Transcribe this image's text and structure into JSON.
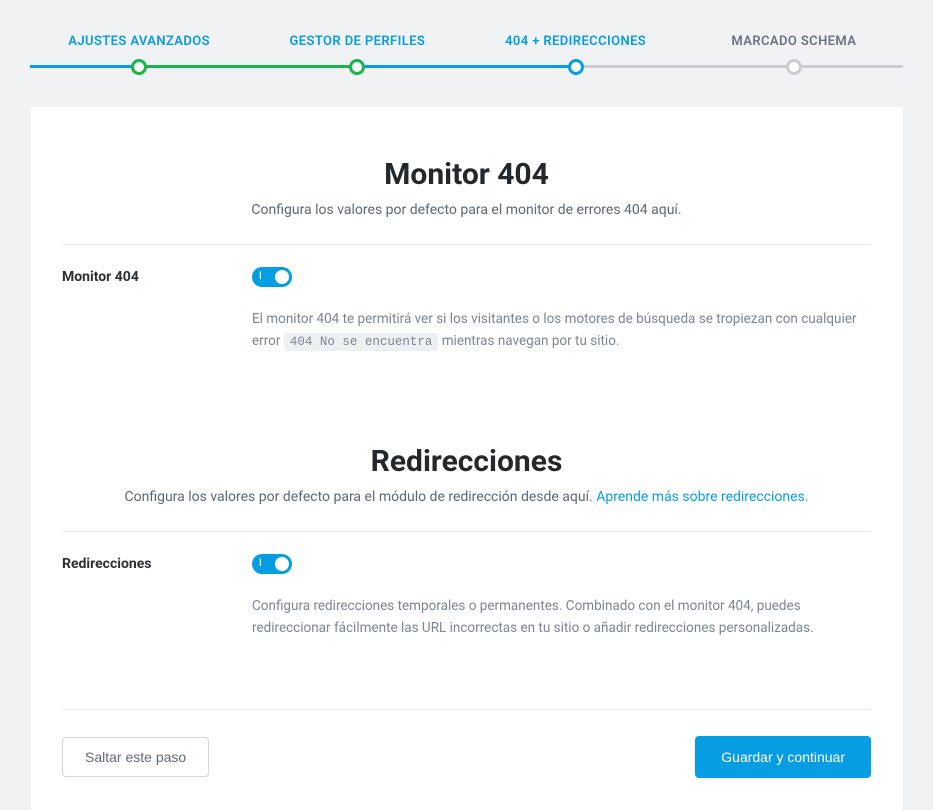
{
  "stepper": {
    "steps": [
      {
        "label": "AJUSTES AVANZADOS",
        "state": "done"
      },
      {
        "label": "GESTOR DE PERFILES",
        "state": "done"
      },
      {
        "label": "404 + REDIRECCIONES",
        "state": "active"
      },
      {
        "label": "MARCADO SCHEMA",
        "state": "pending"
      }
    ]
  },
  "section_monitor": {
    "title": "Monitor 404",
    "description": "Configura los valores por defecto para el monitor de errores 404 aquí.",
    "setting_label": "Monitor 404",
    "toggle_on": true,
    "help_before": "El monitor 404 te permitirá ver si los visitantes o los motores de búsqueda se tropiezan con cualquier error ",
    "code": "404 No se encuentra",
    "help_after": " mientras navegan por tu sitio."
  },
  "section_redirects": {
    "title": "Redirecciones",
    "description_before": "Configura los valores por defecto para el módulo de redirección desde aquí. ",
    "link_text": "Aprende más sobre redirecciones.",
    "setting_label": "Redirecciones",
    "toggle_on": true,
    "help": "Configura redirecciones temporales o permanentes. Combinado con el monitor 404, puedes redireccionar fácilmente las URL incorrectas en tu sitio o añadir redirecciones personalizadas."
  },
  "footer": {
    "skip": "Saltar este paso",
    "save": "Guardar y continuar"
  }
}
